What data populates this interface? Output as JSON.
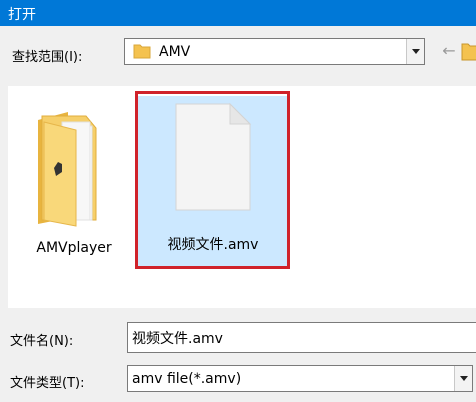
{
  "window": {
    "title": "打开"
  },
  "lookin": {
    "label": "查找范围(I):",
    "value": "AMV"
  },
  "files": [
    {
      "name": "AMVplayer",
      "type": "folder",
      "selected": false
    },
    {
      "name": "视频文件.amv",
      "type": "file",
      "selected": true
    }
  ],
  "filename": {
    "label": "文件名(N):",
    "value": "视频文件.amv"
  },
  "filetype": {
    "label": "文件类型(T):",
    "value": "amv file(*.amv)"
  },
  "colors": {
    "titlebar": "#0078d7",
    "selection": "#cce8ff",
    "highlight_border": "#d0222a",
    "folder": "#f4c24f"
  },
  "icons": {
    "back": "back-arrow-icon",
    "up": "up-folder-icon",
    "folder": "folder-icon",
    "file": "document-icon"
  }
}
